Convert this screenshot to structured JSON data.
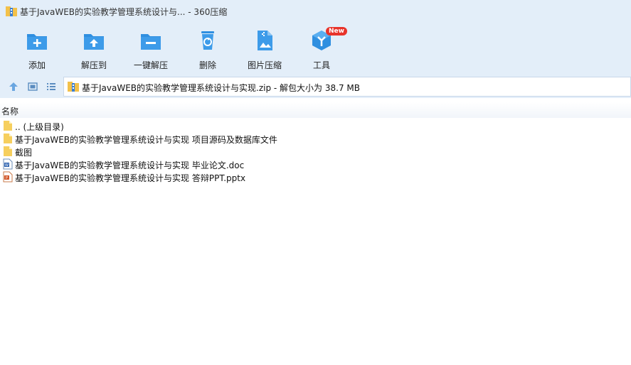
{
  "window": {
    "title": "基于JavaWEB的实验教学管理系统设计与... - 360压缩"
  },
  "toolbar": {
    "add": "添加",
    "extract_to": "解压到",
    "one_click_extract": "一键解压",
    "delete": "删除",
    "image_compress": "图片压缩",
    "tools": "工具",
    "new_badge": "New"
  },
  "address": {
    "path": "基于JavaWEB的实验教学管理系统设计与实现.zip - 解包大小为 38.7 MB"
  },
  "columns": {
    "name": "名称"
  },
  "files": [
    {
      "name": ".. (上级目录)",
      "icon": "folder-icon"
    },
    {
      "name": "基于JavaWEB的实验教学管理系统设计与实现 项目源码及数据库文件",
      "icon": "folder-icon"
    },
    {
      "name": "截图",
      "icon": "folder-icon"
    },
    {
      "name": "基于JavaWEB的实验教学管理系统设计与实现 毕业论文.doc",
      "icon": "word-doc-icon"
    },
    {
      "name": "基于JavaWEB的实验教学管理系统设计与实现 答辩PPT.pptx",
      "icon": "ppt-icon"
    }
  ],
  "colors": {
    "accent": "#2f8fe0",
    "chrome": "#e3eef9",
    "badge": "#e8332a"
  }
}
